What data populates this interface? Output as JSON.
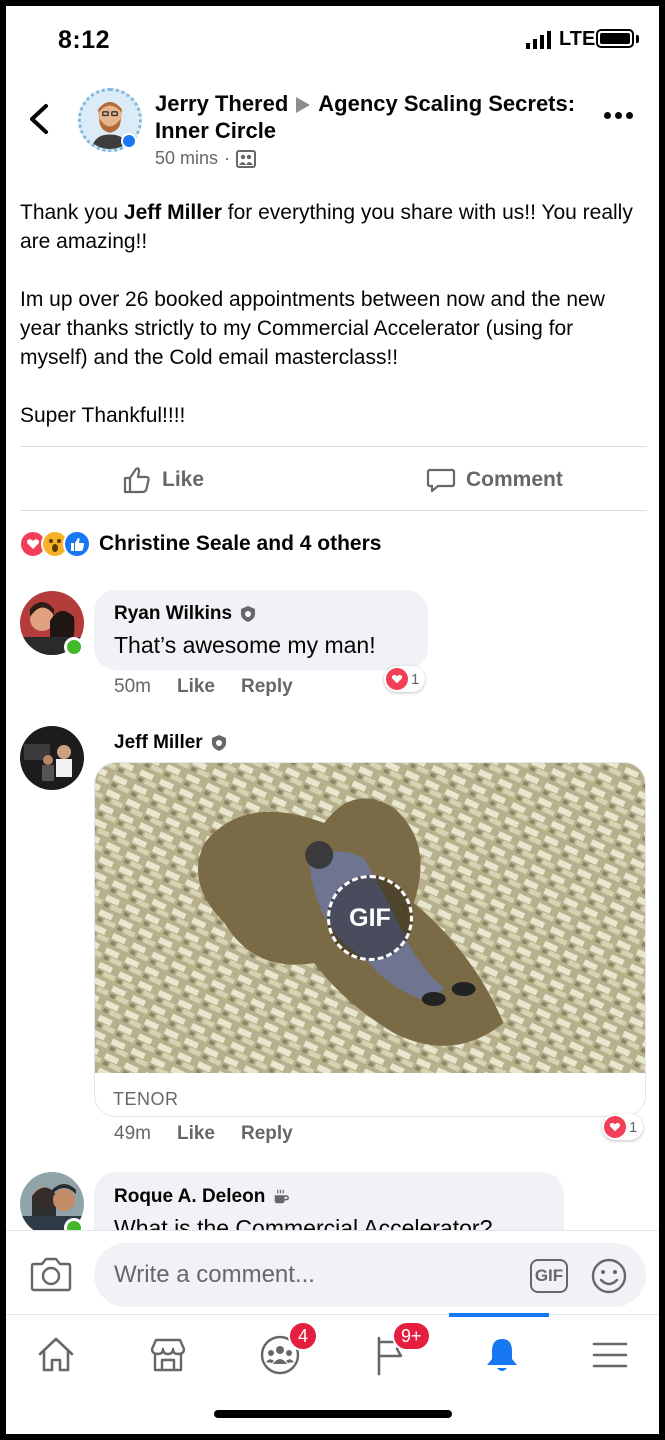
{
  "status_bar": {
    "time": "8:12",
    "network": "LTE"
  },
  "header": {
    "author": "Jerry Thered",
    "group": "Agency Scaling Secrets: Inner Circle",
    "time": "50 mins",
    "separator": "·"
  },
  "post": {
    "paragraph1_prefix": "Thank you ",
    "paragraph1_mention": "Jeff Miller",
    "paragraph1_suffix": " for everything you share with us!! You really are amazing!!",
    "paragraph2": "Im up over 26 booked appointments between now and the new year thanks strictly to my Commercial Accelerator (using for myself) and the Cold email masterclass!!",
    "paragraph3": "Super Thankful!!!!"
  },
  "actions": {
    "like": "Like",
    "comment": "Comment"
  },
  "reactions": {
    "summary": "Christine Seale and 4 others",
    "types": [
      "love",
      "wow",
      "like"
    ]
  },
  "comments": [
    {
      "name": "Ryan Wilkins",
      "text": "That’s awesome my man!",
      "time": "50m",
      "like": "Like",
      "reply": "Reply",
      "reaction_count": "1"
    },
    {
      "name": "Jeff Miller",
      "gif_label": "GIF",
      "gif_source": "TENOR",
      "time": "49m",
      "like": "Like",
      "reply": "Reply",
      "reaction_count": "1"
    },
    {
      "name": "Roque A. Deleon",
      "text": "What is the Commercial Accelerator?"
    }
  ],
  "composer": {
    "placeholder": "Write a comment...",
    "gif_button": "GIF"
  },
  "nav": {
    "items": [
      "home",
      "marketplace",
      "groups",
      "pages",
      "notifications",
      "menu"
    ],
    "groups_badge": "4",
    "pages_badge": "9+",
    "active": "notifications"
  },
  "colors": {
    "accent": "#1877f2",
    "love": "#f33e58",
    "badge": "#e41e3f",
    "online": "#42b72a"
  }
}
